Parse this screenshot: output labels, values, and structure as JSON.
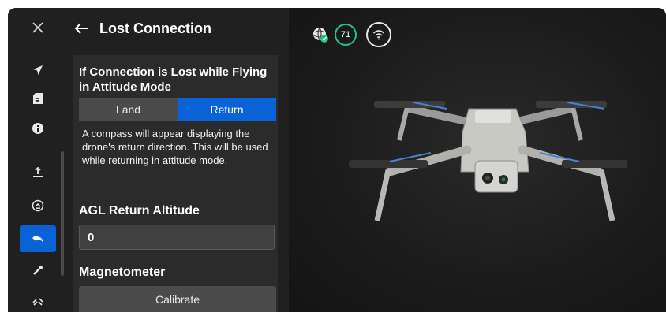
{
  "header": {
    "title": "Lost Connection"
  },
  "attitude": {
    "title": "If Connection is Lost while Flying in Attitude Mode",
    "options": [
      "Land",
      "Return"
    ],
    "selected": "Return",
    "description": "A compass will appear displaying the drone's return direction. This will be used while returning in attitude mode."
  },
  "agl": {
    "label": "AGL Return Altitude",
    "value": "0"
  },
  "magnetometer": {
    "label": "Magnetometer",
    "button": "Calibrate"
  },
  "status": {
    "battery": "71"
  },
  "rail": {
    "items": [
      "close-icon",
      "navigation-icon",
      "sd-card-icon",
      "info-icon",
      "upload-icon",
      "return-home-icon",
      "lost-connection-icon",
      "wrench-icon",
      "pairing-icon"
    ],
    "active": "lost-connection-icon"
  },
  "colors": {
    "accent": "#0a63d6",
    "battery_ring": "#26c281",
    "background": "#1b1b1b"
  }
}
